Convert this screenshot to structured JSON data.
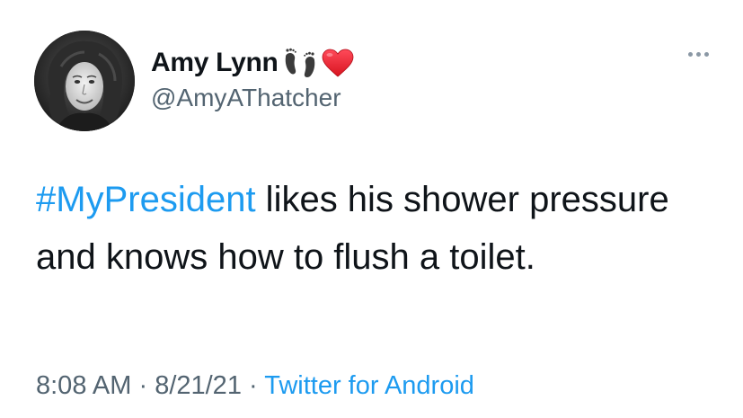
{
  "user": {
    "display_name": "Amy Lynn",
    "handle": "@AmyAThatcher",
    "name_emojis": [
      "footprints-icon",
      "red-heart-icon"
    ]
  },
  "tweet": {
    "hashtag": "#MyPresident",
    "text": " likes his shower pressure and knows how to flush a toilet."
  },
  "meta": {
    "time": "8:08 AM",
    "separator1": " · ",
    "date": "8/21/21",
    "separator2": " · ",
    "source": "Twitter for Android"
  },
  "colors": {
    "link": "#1d9bf0",
    "secondary_text": "#536471",
    "heart": "#e0245e"
  }
}
